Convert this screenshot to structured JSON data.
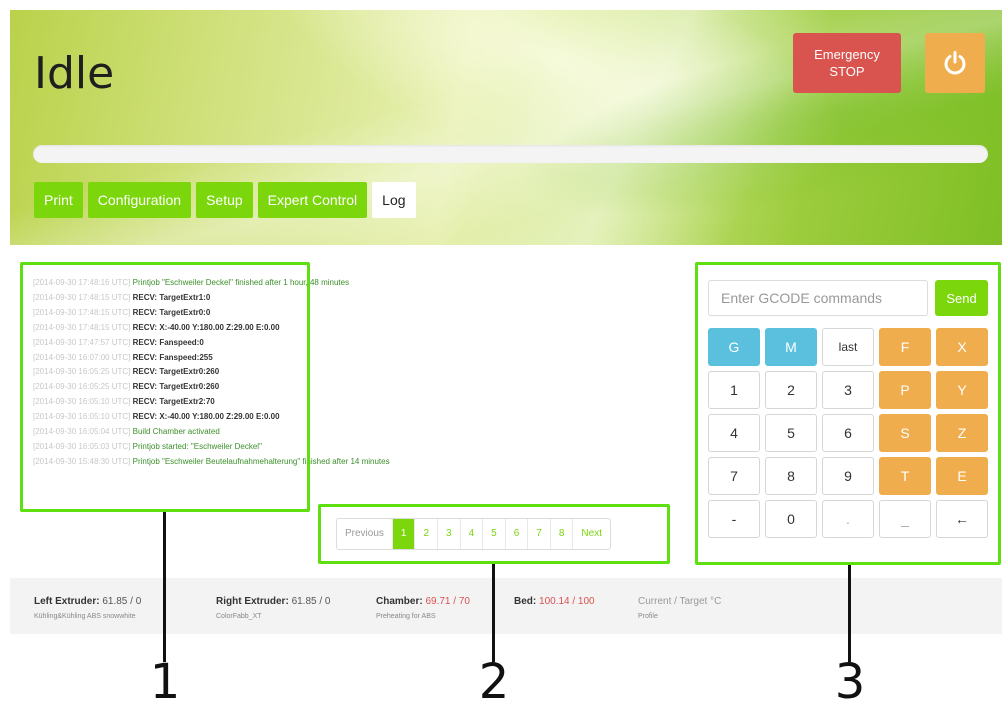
{
  "header": {
    "status": "Idle",
    "estop_line1": "Emergency",
    "estop_line2": "STOP",
    "power_icon": "power-icon",
    "progress": 0
  },
  "tabs": [
    {
      "label": "Print",
      "active": false
    },
    {
      "label": "Configuration",
      "active": false
    },
    {
      "label": "Setup",
      "active": false
    },
    {
      "label": "Expert Control",
      "active": false
    },
    {
      "label": "Log",
      "active": true
    }
  ],
  "log": [
    {
      "ts": "[2014-09-30 17:48:16 UTC]",
      "msg": "Printjob \"Eschweiler Deckel\" finished after 1 hour, 48 minutes",
      "green": true
    },
    {
      "ts": "[2014-09-30 17:48:15 UTC]",
      "msg": "RECV: TargetExtr1:0",
      "green": false
    },
    {
      "ts": "[2014-09-30 17:48:15 UTC]",
      "msg": "RECV: TargetExtr0:0",
      "green": false
    },
    {
      "ts": "[2014-09-30 17:48:15 UTC]",
      "msg": "RECV: X:-40.00 Y:180.00 Z:29.00 E:0.00",
      "green": false
    },
    {
      "ts": "[2014-09-30 17:47:57 UTC]",
      "msg": "RECV: Fanspeed:0",
      "green": false
    },
    {
      "ts": "[2014-09-30 16:07:00 UTC]",
      "msg": "RECV: Fanspeed:255",
      "green": false
    },
    {
      "ts": "[2014-09-30 16:05:25 UTC]",
      "msg": "RECV: TargetExtr0:260",
      "green": false
    },
    {
      "ts": "[2014-09-30 16:05:25 UTC]",
      "msg": "RECV: TargetExtr0:260",
      "green": false
    },
    {
      "ts": "[2014-09-30 16:05:10 UTC]",
      "msg": "RECV: TargetExtr2:70",
      "green": false
    },
    {
      "ts": "[2014-09-30 16:05:10 UTC]",
      "msg": "RECV: X:-40.00 Y:180.00 Z:29.00 E:0.00",
      "green": false
    },
    {
      "ts": "[2014-09-30 16:05:04 UTC]",
      "msg": "Build Chamber activated",
      "green": true
    },
    {
      "ts": "[2014-09-30 16:05:03 UTC]",
      "msg": "Printjob started: \"Eschweiler Deckel\"",
      "green": true
    },
    {
      "ts": "[2014-09-30 15:48:30 UTC]",
      "msg": "Printjob \"Eschweiler Beutelaufnahmehalterung\" finished after 14 minutes",
      "green": true
    }
  ],
  "pagination": {
    "prev": "Previous",
    "pages": [
      "1",
      "2",
      "3",
      "4",
      "5",
      "6",
      "7",
      "8"
    ],
    "active": "1",
    "next": "Next"
  },
  "gcode": {
    "placeholder": "Enter GCODE commands",
    "send_label": "Send"
  },
  "keypad": [
    {
      "label": "G",
      "style": "blue"
    },
    {
      "label": "M",
      "style": "blue"
    },
    {
      "label": "last",
      "style": "last"
    },
    {
      "label": "F",
      "style": "orange"
    },
    {
      "label": "X",
      "style": "orange"
    },
    {
      "label": "1",
      "style": ""
    },
    {
      "label": "2",
      "style": ""
    },
    {
      "label": "3",
      "style": ""
    },
    {
      "label": "P",
      "style": "orange"
    },
    {
      "label": "Y",
      "style": "orange"
    },
    {
      "label": "4",
      "style": ""
    },
    {
      "label": "5",
      "style": ""
    },
    {
      "label": "6",
      "style": ""
    },
    {
      "label": "S",
      "style": "orange"
    },
    {
      "label": "Z",
      "style": "orange"
    },
    {
      "label": "7",
      "style": ""
    },
    {
      "label": "8",
      "style": ""
    },
    {
      "label": "9",
      "style": ""
    },
    {
      "label": "T",
      "style": "orange"
    },
    {
      "label": "E",
      "style": "orange"
    },
    {
      "label": "-",
      "style": ""
    },
    {
      "label": "0",
      "style": ""
    },
    {
      "label": ".",
      "style": "dim"
    },
    {
      "label": "_",
      "style": "dim"
    },
    {
      "label": "←",
      "style": ""
    }
  ],
  "footer": {
    "left_extruder": {
      "label": "Left Extruder:",
      "value": "61.85 / 0",
      "sub": "Kühling&Kühling ABS snowwhite"
    },
    "right_extruder": {
      "label": "Right Extruder:",
      "value": "61.85 / 0",
      "sub": "ColorFabb_XT"
    },
    "chamber": {
      "label": "Chamber:",
      "value": "69.71 / 70",
      "sub": "Preheating for ABS"
    },
    "bed": {
      "label": "Bed:",
      "value": "100.14 / 100"
    },
    "legend": {
      "label": "Current / Target °C",
      "sub": "Profile"
    }
  },
  "callouts": [
    "1",
    "2",
    "3"
  ],
  "colors": {
    "accent_green": "#7bd60c",
    "highlight_green": "#5ee010",
    "estop_red": "#d9534f",
    "orange": "#f0ad4e",
    "blue": "#5bc0de"
  }
}
